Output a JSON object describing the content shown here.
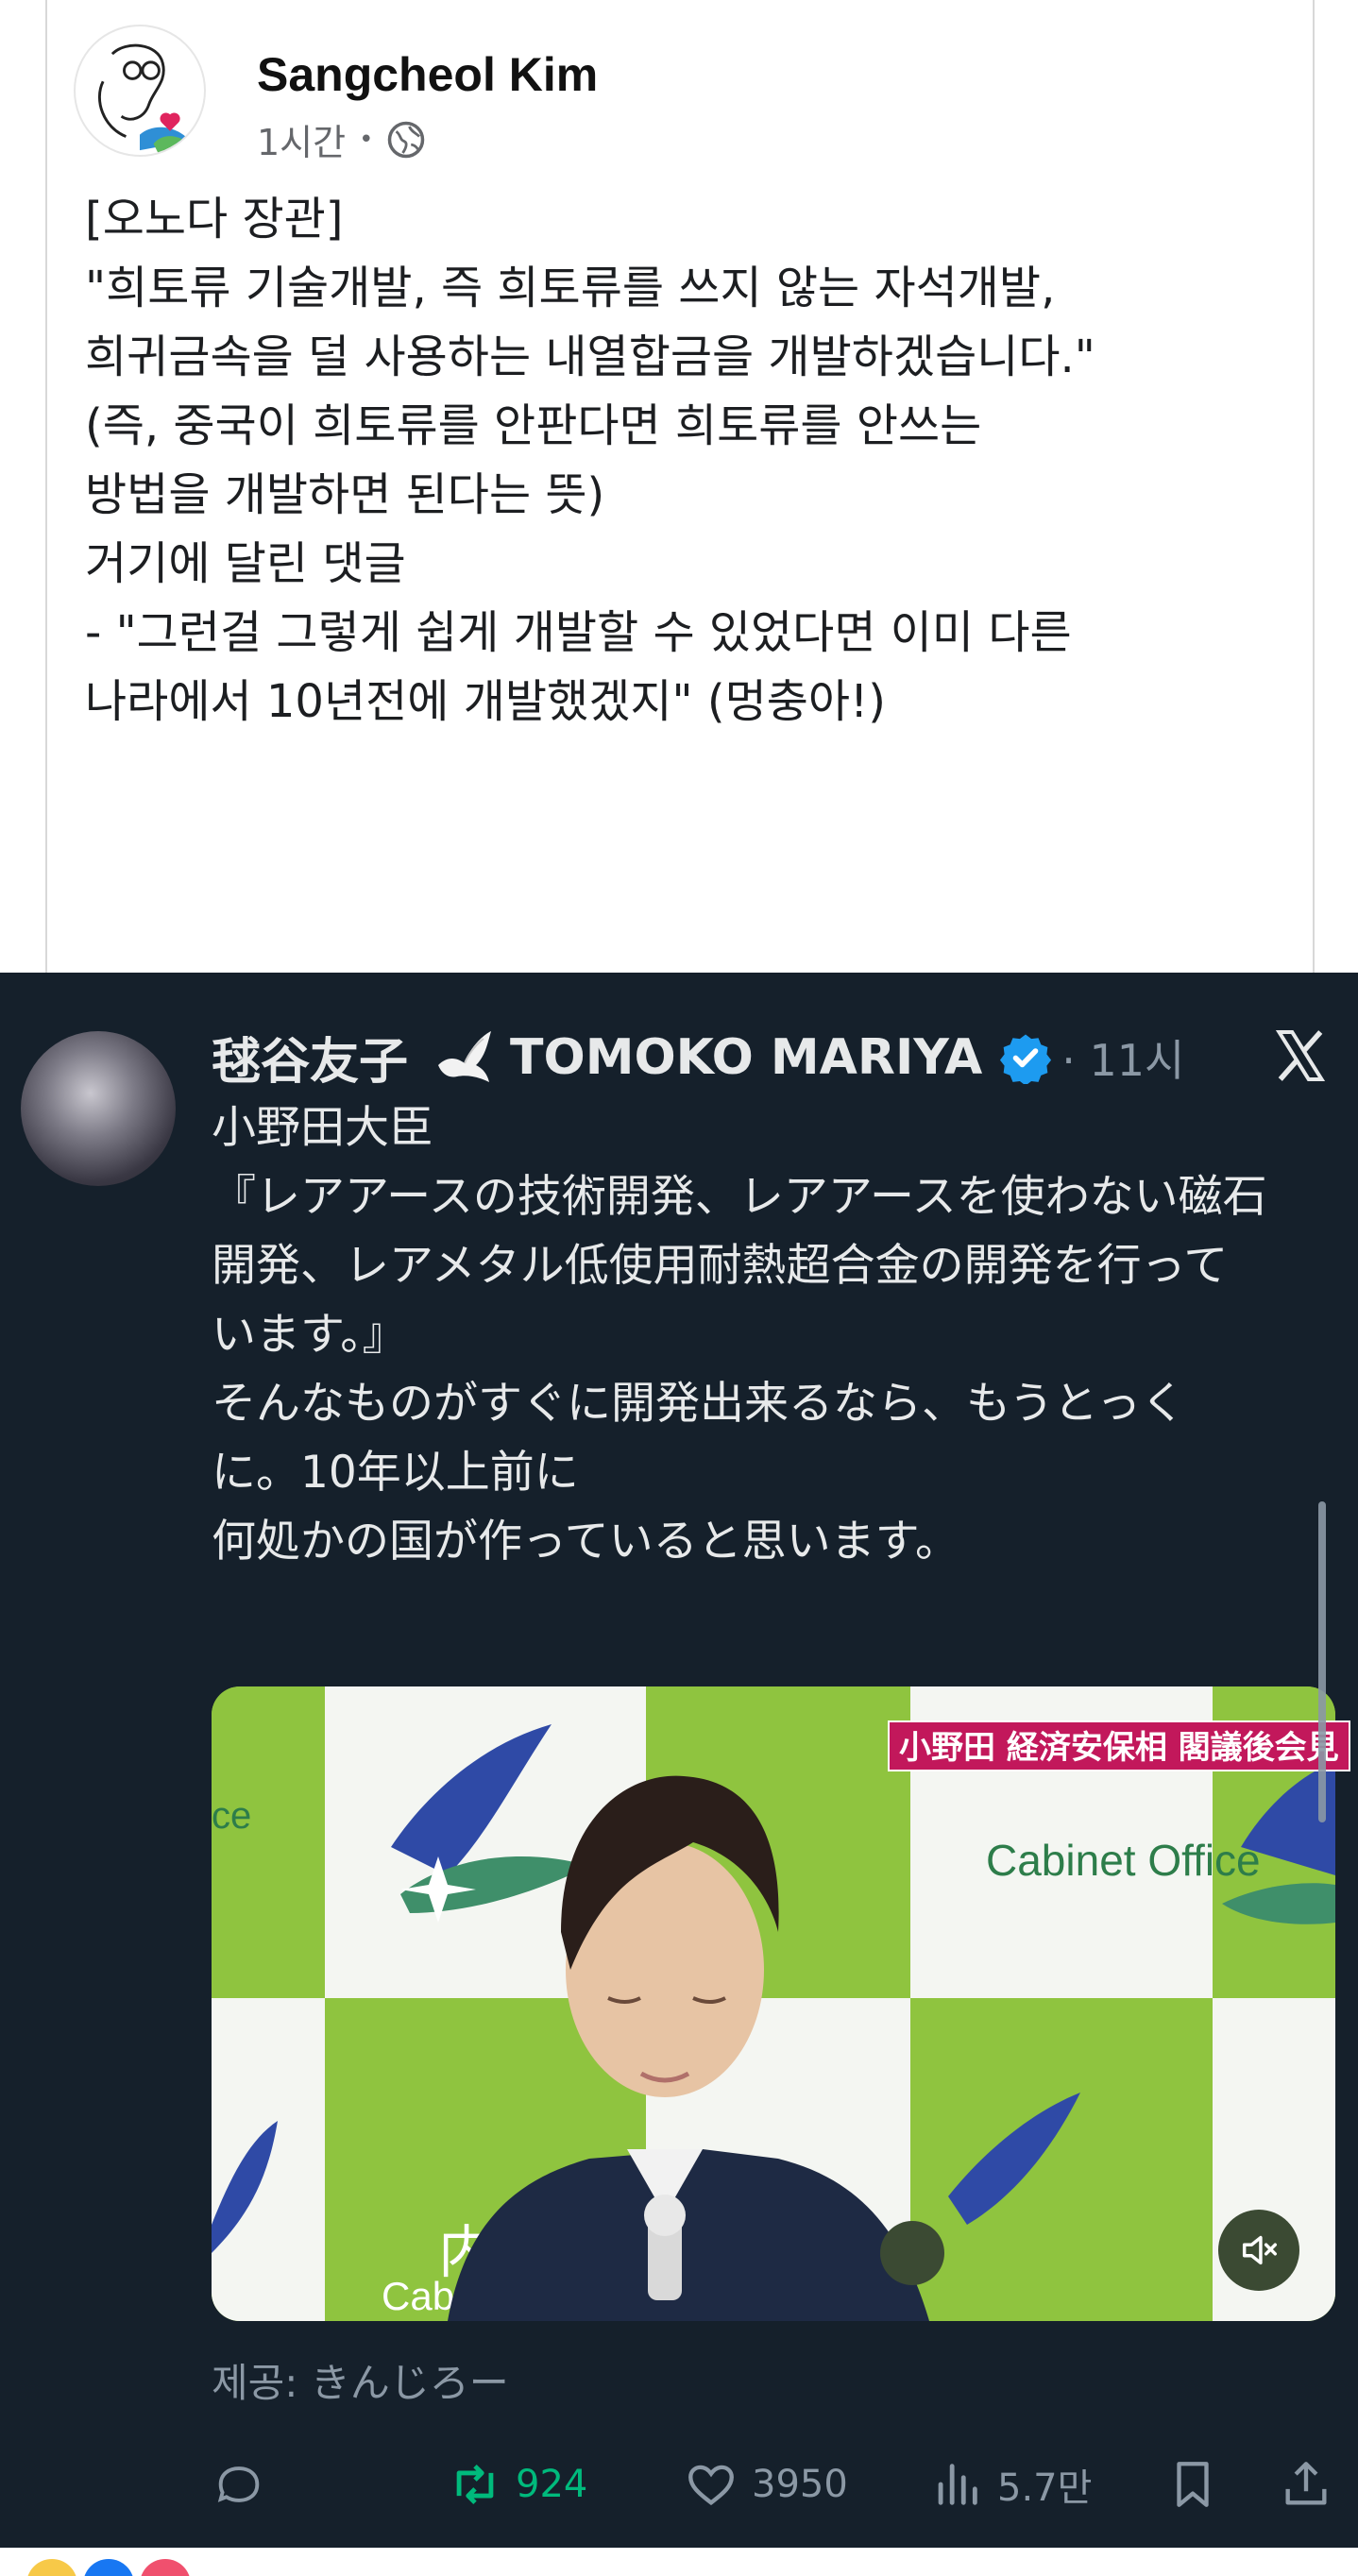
{
  "facebook": {
    "author_name": "Sangcheol Kim",
    "time_ago": "1시간",
    "separator": "•",
    "privacy_icon": "globe-icon",
    "body_lines": [
      "[오노다 장관]",
      "",
      "\"희토류 기술개발, 즉 희토류를 쓰지 않는 자석개발,",
      "희귀금속을 덜 사용하는 내열합금을 개발하겠습니다.\"",
      "(즉, 중국이 희토류를 안판다면 희토류를 안쓰는",
      "방법을 개발하면 된다는 뜻)",
      "",
      "거기에 달린 댓글",
      "",
      "- \"그런걸 그렇게 쉽게 개발할 수 있었다면 이미 다른",
      "나라에서 10년전에 개발했겠지\" (멍충아!)"
    ]
  },
  "tweet": {
    "display_name": "毬谷友子",
    "display_name_latin": "TOMOKO MARIYA",
    "time_ago": "· 11시",
    "body_lines": [
      "小野田大臣",
      "『レアアースの技術開発、レアアースを使わない磁石",
      "開発、レアメタル低使用耐熱超合金の開発を行って",
      "います。』",
      "",
      "そんなものがすぐに開発出来るなら、もうとっく",
      "に。10年以上前に",
      "何処かの国が作っていると思います。"
    ],
    "video_caption": "小野田 経済安保相 閣議後会見",
    "video_sign_text": "Cabinet Office",
    "provided_by": "제공: きんじろー",
    "retweets": "924",
    "likes": "3950",
    "views": "5.7만"
  },
  "colors": {
    "x_background": "#15202b",
    "retweet_green": "#00ba7c",
    "verified_blue": "#1d9bf0",
    "caption_red": "#c2185b"
  }
}
